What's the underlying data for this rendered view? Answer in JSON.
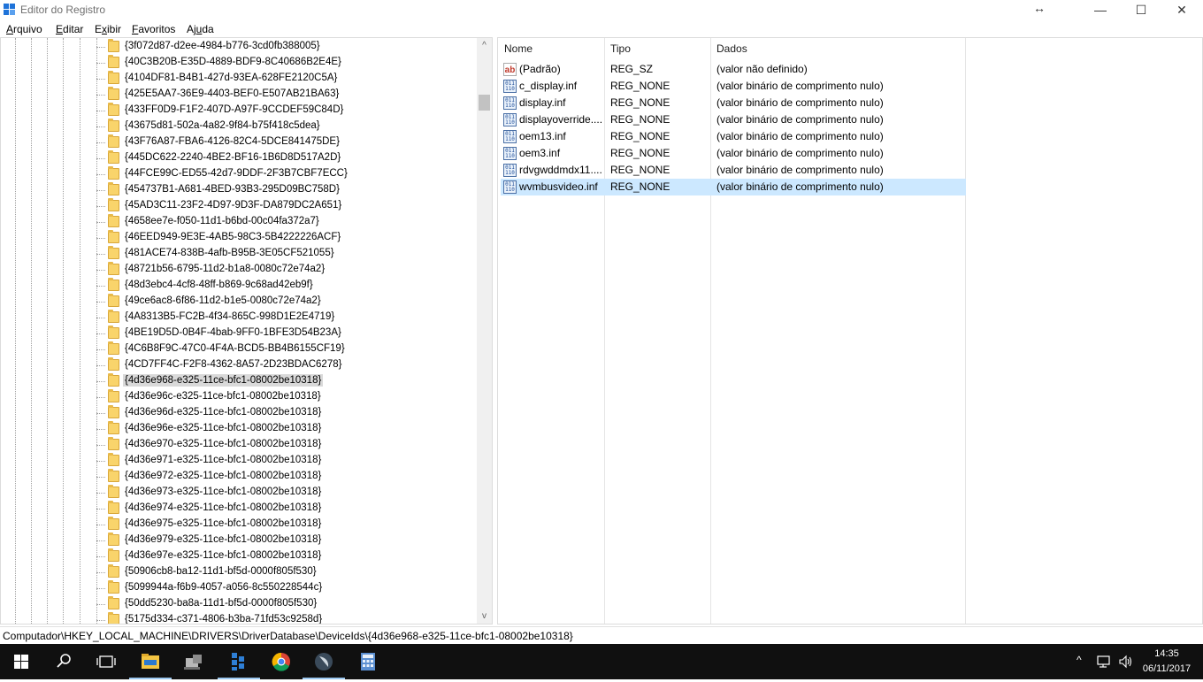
{
  "window": {
    "title": "Editor do Registro",
    "resize_glyph": "↔",
    "minimize_glyph": "—",
    "maximize_glyph": "☐",
    "close_glyph": "✕"
  },
  "menu": {
    "items": [
      {
        "label": "Arquivo",
        "accel": "A",
        "rest": "rquivo"
      },
      {
        "label": "Editar",
        "accel": "E",
        "rest": "ditar"
      },
      {
        "label": "Exibir",
        "accel": "x",
        "pre": "E",
        "rest": "ibir"
      },
      {
        "label": "Favoritos",
        "accel": "F",
        "rest": "avoritos"
      },
      {
        "label": "Ajuda",
        "accel": "u",
        "pre": "Aj",
        "rest": "da"
      }
    ]
  },
  "tree": {
    "items": [
      "{3f072d87-d2ee-4984-b776-3cd0fb388005}",
      "{40C3B20B-E35D-4889-BDF9-8C40686B2E4E}",
      "{4104DF81-B4B1-427d-93EA-628FE2120C5A}",
      "{425E5AA7-36E9-4403-BEF0-E507AB21BA63}",
      "{433FF0D9-F1F2-407D-A97F-9CCDEF59C84D}",
      "{43675d81-502a-4a82-9f84-b75f418c5dea}",
      "{43F76A87-FBA6-4126-82C4-5DCE841475DE}",
      "{445DC622-2240-4BE2-BF16-1B6D8D517A2D}",
      "{44FCE99C-ED55-42d7-9DDF-2F3B7CBF7ECC}",
      "{454737B1-A681-4BED-93B3-295D09BC758D}",
      "{45AD3C11-23F2-4D97-9D3F-DA879DC2A651}",
      "{4658ee7e-f050-11d1-b6bd-00c04fa372a7}",
      "{46EED949-9E3E-4AB5-98C3-5B4222226ACF}",
      "{481ACE74-838B-4afb-B95B-3E05CF521055}",
      "{48721b56-6795-11d2-b1a8-0080c72e74a2}",
      "{48d3ebc4-4cf8-48ff-b869-9c68ad42eb9f}",
      "{49ce6ac8-6f86-11d2-b1e5-0080c72e74a2}",
      "{4A8313B5-FC2B-4f34-865C-998D1E2E4719}",
      "{4BE19D5D-0B4F-4bab-9FF0-1BFE3D54B23A}",
      "{4C6B8F9C-47C0-4F4A-BCD5-BB4B6155CF19}",
      "{4CD7FF4C-F2F8-4362-8A57-2D23BDAC6278}",
      "{4d36e968-e325-11ce-bfc1-08002be10318}",
      "{4d36e96c-e325-11ce-bfc1-08002be10318}",
      "{4d36e96d-e325-11ce-bfc1-08002be10318}",
      "{4d36e96e-e325-11ce-bfc1-08002be10318}",
      "{4d36e970-e325-11ce-bfc1-08002be10318}",
      "{4d36e971-e325-11ce-bfc1-08002be10318}",
      "{4d36e972-e325-11ce-bfc1-08002be10318}",
      "{4d36e973-e325-11ce-bfc1-08002be10318}",
      "{4d36e974-e325-11ce-bfc1-08002be10318}",
      "{4d36e975-e325-11ce-bfc1-08002be10318}",
      "{4d36e979-e325-11ce-bfc1-08002be10318}",
      "{4d36e97e-e325-11ce-bfc1-08002be10318}",
      "{50906cb8-ba12-11d1-bf5d-0000f805f530}",
      "{5099944a-f6b9-4057-a056-8c550228544c}",
      "{50dd5230-ba8a-11d1-bf5d-0000f805f530}",
      "{5175d334-c371-4806-b3ba-71fd53c9258d}"
    ],
    "selected_index": 21,
    "scroll_up_glyph": "^",
    "scroll_down_glyph": "v"
  },
  "list": {
    "columns": [
      "Nome",
      "Tipo",
      "Dados"
    ],
    "rows": [
      {
        "icon": "string-value-icon",
        "name": "(Padrão)",
        "type": "REG_SZ",
        "data": "(valor não definido)"
      },
      {
        "icon": "binary-value-icon",
        "name": "c_display.inf",
        "type": "REG_NONE",
        "data": "(valor binário de comprimento nulo)"
      },
      {
        "icon": "binary-value-icon",
        "name": "display.inf",
        "type": "REG_NONE",
        "data": "(valor binário de comprimento nulo)"
      },
      {
        "icon": "binary-value-icon",
        "name": "displayoverride....",
        "type": "REG_NONE",
        "data": "(valor binário de comprimento nulo)"
      },
      {
        "icon": "binary-value-icon",
        "name": "oem13.inf",
        "type": "REG_NONE",
        "data": "(valor binário de comprimento nulo)"
      },
      {
        "icon": "binary-value-icon",
        "name": "oem3.inf",
        "type": "REG_NONE",
        "data": "(valor binário de comprimento nulo)"
      },
      {
        "icon": "binary-value-icon",
        "name": "rdvgwddmdx11....",
        "type": "REG_NONE",
        "data": "(valor binário de comprimento nulo)"
      },
      {
        "icon": "binary-value-icon",
        "name": "wvmbusvideo.inf",
        "type": "REG_NONE",
        "data": "(valor binário de comprimento nulo)"
      }
    ],
    "selected_index": 7
  },
  "statusbar": {
    "path": "Computador\\HKEY_LOCAL_MACHINE\\DRIVERS\\DriverDatabase\\DeviceIds\\{4d36e968-e325-11ce-bfc1-08002be10318}"
  },
  "taskbar": {
    "icons": [
      "start-icon",
      "search-icon",
      "task-view-icon",
      "file-explorer-icon",
      "network-app-icon",
      "regedit-icon",
      "chrome-icon",
      "media-app-icon",
      "calculator-icon"
    ],
    "tray_arrow": "^",
    "time": "14:35",
    "date": "06/11/2017"
  },
  "colors": {
    "selection": "#cce8ff",
    "tree_selection": "#d9d9d9",
    "taskbar": "#101010",
    "accent": "#1e73d9"
  }
}
